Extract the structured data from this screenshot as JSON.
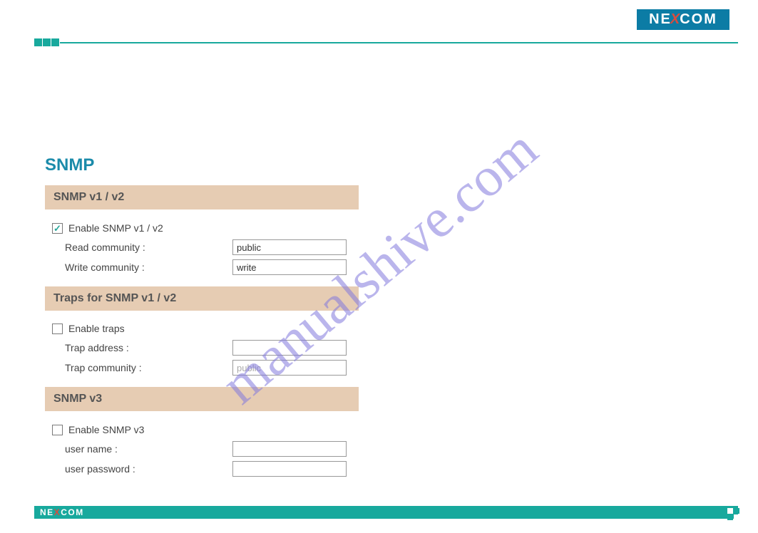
{
  "brand": {
    "name_part1": "NE",
    "name_x": "X",
    "name_part2": "COM"
  },
  "watermark": "manualshive.com",
  "page": {
    "title": "SNMP"
  },
  "sections": {
    "snmp_v1v2": {
      "header": "SNMP v1 / v2",
      "enable_label": "Enable SNMP v1 / v2",
      "enable_checked": true,
      "read_community_label": "Read community :",
      "read_community_value": "public",
      "write_community_label": "Write community :",
      "write_community_value": "write"
    },
    "traps": {
      "header": "Traps for SNMP v1 / v2",
      "enable_label": "Enable traps",
      "enable_checked": false,
      "trap_address_label": "Trap address :",
      "trap_address_value": "",
      "trap_community_label": "Trap community :",
      "trap_community_value": "public"
    },
    "snmp_v3": {
      "header": "SNMP v3",
      "enable_label": "Enable SNMP v3",
      "enable_checked": false,
      "username_label": "user name :",
      "username_value": "",
      "password_label": "user password :",
      "password_value": ""
    }
  }
}
